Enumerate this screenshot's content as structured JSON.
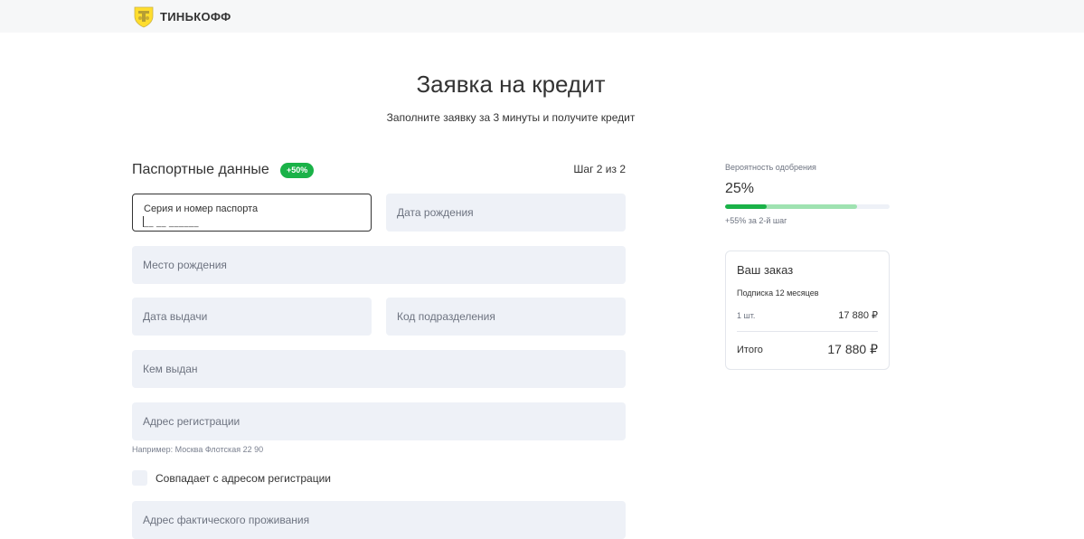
{
  "header": {
    "logo_text": "ТИНЬКОФФ",
    "logo_icon": "tinkoff-emblem-icon"
  },
  "page": {
    "title": "Заявка на кредит",
    "subtitle": "Заполните заявку за 3 минуты и получите кредит"
  },
  "form": {
    "section_title": "Паспортные данные",
    "badge": "+50%",
    "step": "Шаг 2 из 2",
    "fields": {
      "passport": {
        "placeholder": "Серия и номер паспорта",
        "mask": "__ __ ______"
      },
      "birth_date": {
        "placeholder": "Дата рождения"
      },
      "birth_place": {
        "placeholder": "Место рождения"
      },
      "issue_date": {
        "placeholder": "Дата выдачи"
      },
      "division_code": {
        "placeholder": "Код подразделения"
      },
      "issued_by": {
        "placeholder": "Кем выдан"
      },
      "registration_address": {
        "placeholder": "Адрес регистрации"
      },
      "actual_address": {
        "placeholder": "Адрес фактического проживания"
      }
    },
    "address_hint": "Например: Москва Флотская 22 90",
    "same_address_checkbox": {
      "label": "Совпадает с адресом регистрации",
      "checked": false
    }
  },
  "approval": {
    "label": "Вероятность одобрения",
    "value": "25%",
    "progress_fraction": 0.25,
    "boost_fraction": 0.8,
    "note": "+55% за 2-й шаг"
  },
  "order": {
    "title": "Ваш заказ",
    "product": "Подписка 12 месяцев",
    "quantity": "1 шт.",
    "price": "17 880 ₽",
    "total_label": "Итого",
    "total": "17 880 ₽"
  },
  "colors": {
    "accent_green": "#1ab248",
    "light_green": "#9fe2b1",
    "field_bg": "#eef1f7",
    "logo_yellow": "#ffdd2d"
  }
}
